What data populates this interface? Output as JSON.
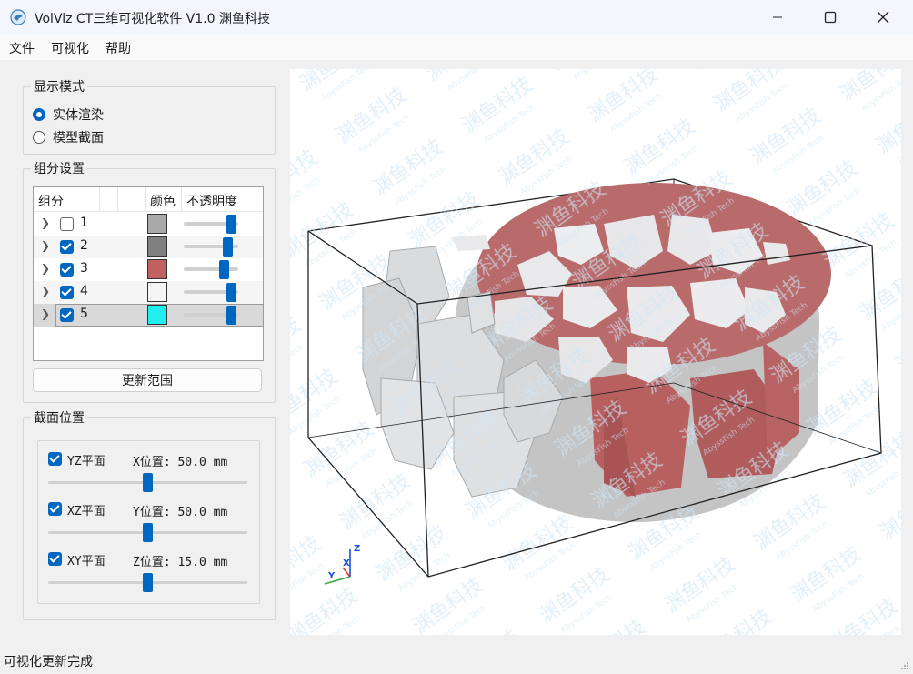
{
  "window": {
    "title": "VolViz CT三维可视化软件 V1.0 渊鱼科技",
    "icons": {
      "app": "app-logo-icon",
      "minimize": "minimize-icon",
      "maximize": "maximize-icon",
      "close": "close-icon"
    }
  },
  "menu": {
    "items": [
      "文件",
      "可视化",
      "帮助"
    ]
  },
  "display_mode": {
    "title": "显示模式",
    "options": [
      {
        "label": "实体渲染",
        "selected": true
      },
      {
        "label": "模型截面",
        "selected": false
      }
    ]
  },
  "component_settings": {
    "title": "组分设置",
    "headers": {
      "component": "组分",
      "color": "颜色",
      "opacity": "不透明度"
    },
    "rows": [
      {
        "id": "1",
        "checked": false,
        "color": "#a9a9a9",
        "opacity": 0.9
      },
      {
        "id": "2",
        "checked": true,
        "color": "#808080",
        "opacity": 0.82
      },
      {
        "id": "3",
        "checked": true,
        "color": "#c06060",
        "opacity": 0.75
      },
      {
        "id": "4",
        "checked": true,
        "color": "#f5f5f5",
        "opacity": 0.9
      },
      {
        "id": "5",
        "checked": true,
        "color": "#22eef0",
        "opacity": 0.9
      }
    ],
    "update_button": "更新范围"
  },
  "section_position": {
    "title": "截面位置",
    "planes": [
      {
        "label": "YZ平面",
        "checked": true,
        "value_text": "X位置: 50.0 mm",
        "fraction": 0.5
      },
      {
        "label": "XZ平面",
        "checked": true,
        "value_text": "Y位置: 50.0 mm",
        "fraction": 0.5
      },
      {
        "label": "XY平面",
        "checked": true,
        "value_text": "Z位置: 15.0 mm",
        "fraction": 0.5
      }
    ]
  },
  "viewport": {
    "watermark": "渊鱼科技",
    "watermark_sub": "AbyssFish Tech",
    "axes": {
      "x": "X",
      "y": "Y",
      "z": "Z"
    }
  },
  "status": {
    "text": "可视化更新完成"
  }
}
